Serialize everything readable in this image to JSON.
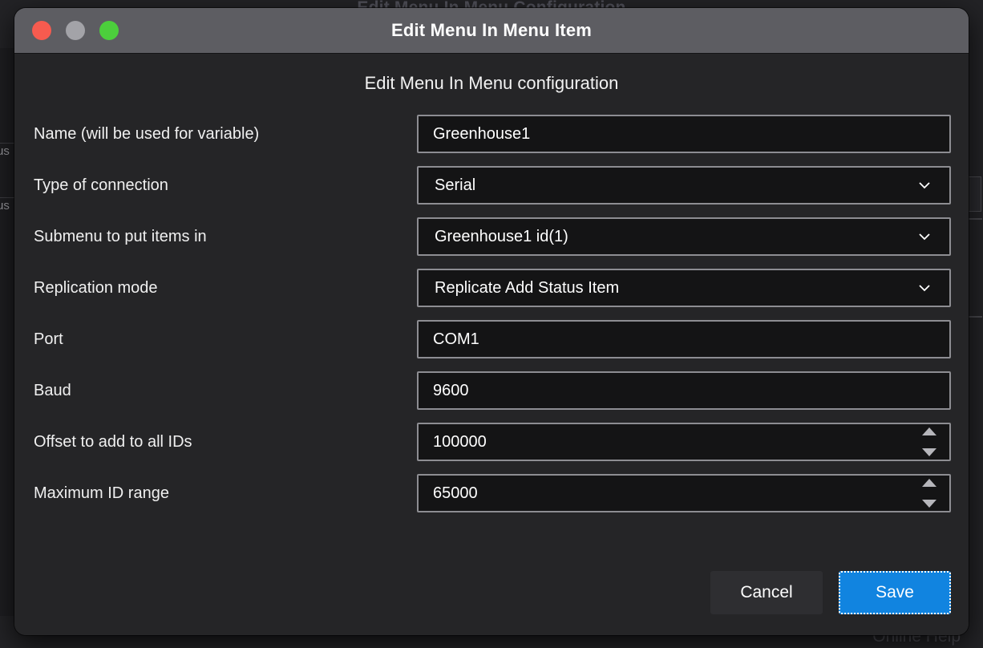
{
  "background_window": {
    "title": "Edit Menu In Menu Configuration",
    "left_edge_labels": [
      "us",
      "us"
    ],
    "help_link": "Online Help"
  },
  "dialog": {
    "title": "Edit Menu In Menu Item",
    "subtitle": "Edit Menu In Menu configuration",
    "window_controls": {
      "close": "close-button",
      "minimize": "minimize-button",
      "maximize": "maximize-button",
      "close_color": "#f75b4f",
      "minimize_color": "#a3a3a8",
      "maximize_color": "#4ccf3c"
    },
    "fields": [
      {
        "label": "Name (will be used for variable)",
        "value": "Greenhouse1",
        "type": "text",
        "name": "name-field"
      },
      {
        "label": "Type of connection",
        "value": "Serial",
        "type": "select",
        "name": "type-of-connection-select"
      },
      {
        "label": "Submenu to put items in",
        "value": "Greenhouse1 id(1)",
        "type": "select",
        "name": "submenu-select"
      },
      {
        "label": "Replication mode",
        "value": "Replicate Add Status Item",
        "type": "select",
        "name": "replication-mode-select"
      },
      {
        "label": "Port",
        "value": "COM1",
        "type": "text",
        "name": "port-field"
      },
      {
        "label": "Baud",
        "value": "9600",
        "type": "text",
        "name": "baud-field"
      },
      {
        "label": "Offset to add to all IDs",
        "value": "100000",
        "type": "spinner",
        "name": "offset-spinner"
      },
      {
        "label": "Maximum ID range",
        "value": "65000",
        "type": "spinner",
        "name": "maximum-id-range-spinner"
      }
    ],
    "buttons": {
      "cancel": "Cancel",
      "save": "Save",
      "save_color": "#1184e0",
      "save_focused": true
    }
  }
}
